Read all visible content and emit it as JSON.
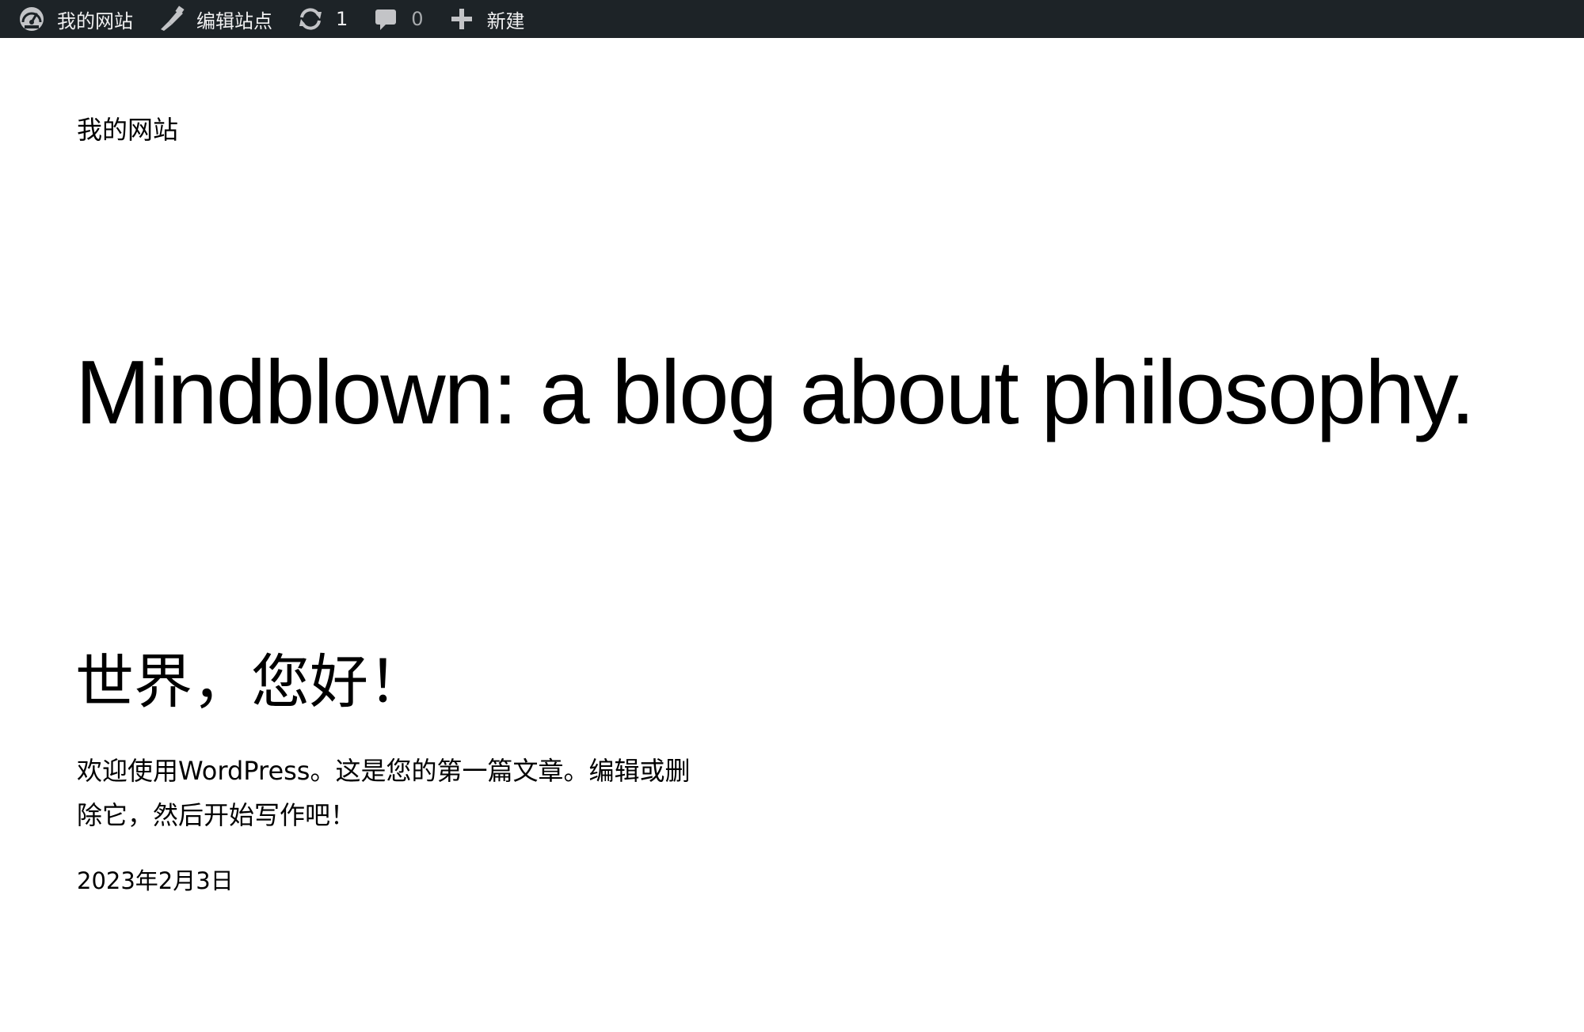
{
  "admin_bar": {
    "site_name": "我的网站",
    "edit_site": "编辑站点",
    "updates_count": "1",
    "comments_count": "0",
    "new_label": "新建",
    "icons": [
      "dashboard-icon",
      "brush-icon",
      "updates-icon",
      "comment-icon",
      "plus-icon"
    ]
  },
  "header": {
    "site_title": "我的网站"
  },
  "hero": {
    "heading": "Mindblown: a blog about philosophy."
  },
  "post": {
    "title": "世界，您好！",
    "excerpt": "欢迎使用WordPress。这是您的第一篇文章。编辑或删除它，然后开始写作吧！",
    "date": "2023年2月3日"
  },
  "colors": {
    "admin_bar_bg": "#1d2327",
    "admin_bar_text": "#f0f0f1",
    "page_bg": "#ffffff",
    "text": "#000000"
  }
}
